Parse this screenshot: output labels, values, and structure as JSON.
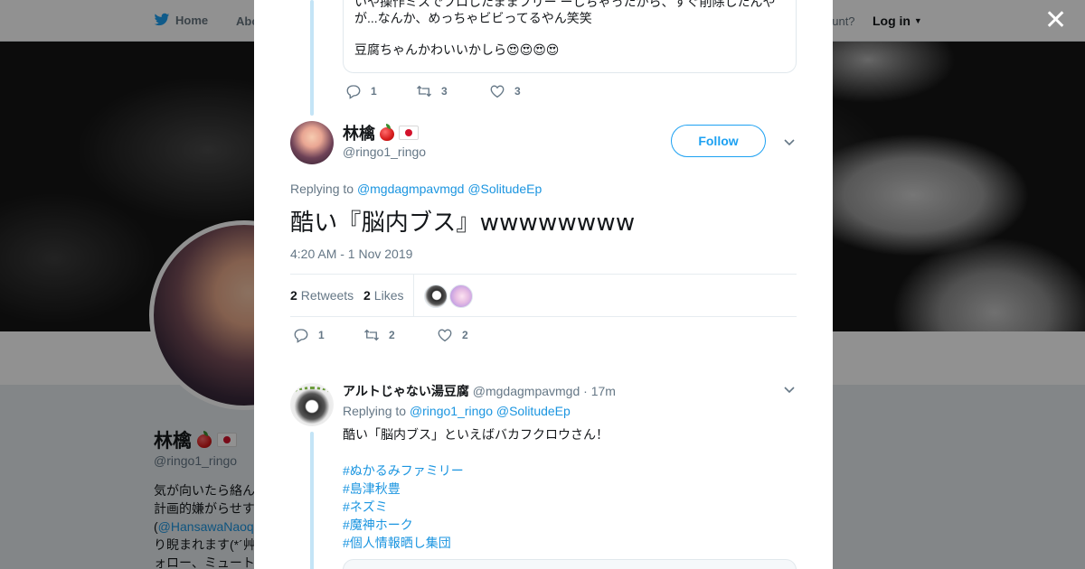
{
  "topbar": {
    "home_label": "Home",
    "about_label": "Abo",
    "account_prompt": "ccount?",
    "login_label": "Log in",
    "brand_color": "#1da1f2"
  },
  "profile": {
    "name": "林檎",
    "handle": "@ringo1_ringo",
    "bio_lines": [
      "気が向いたら絡ん",
      "計画的嫌がらせす",
      "(@HansawaNaoq",
      "り睨まれます(*´艸",
      "ォロー、ミュート"
    ],
    "bio_mention": "@HansawaNaoq"
  },
  "modal": {
    "close_icon": "close-icon",
    "quoted_tweet": {
      "line1": "いや操作ミスでフロしたままフリー ーしちゃったから、すぐ削除したんや",
      "line2": "が...なんか、めっちゃビビってるやん笑笑",
      "line3": "豆腐ちゃんかわいいかしら😍😍😍😍"
    },
    "parent_actions": {
      "replies": "1",
      "retweets": "3",
      "likes": "3"
    },
    "main_tweet": {
      "name": "林檎",
      "handle": "@ringo1_ringo",
      "follow_label": "Follow",
      "replying_to_prefix": "Replying to",
      "replying_to": [
        "@mgdagmpavmgd",
        "@SolitudeEp"
      ],
      "text": "酷い『脳内ブス』wwwwwwww",
      "timestamp": "4:20 AM - 1 Nov 2019",
      "retweets_count": "2",
      "retweets_label": "Retweets",
      "likes_count": "2",
      "likes_label": "Likes",
      "actions": {
        "replies": "1",
        "retweets": "2",
        "likes": "2"
      }
    },
    "reply_tweet": {
      "name": "アルトじゃない湯豆腐",
      "handle": "@mgdagmpavmgd",
      "time": "· 17m",
      "replying_to_prefix": "Replying to",
      "replying_to": [
        "@ringo1_ringo",
        "@SolitudeEp"
      ],
      "text": "酷い「脳内ブス」といえばバカフクロウさん！",
      "hashtags": [
        "#ぬかるみファミリー",
        "#島津秋豊",
        "#ネズミ",
        "#魔神ホーク",
        "#個人情報晒し集団"
      ]
    }
  }
}
